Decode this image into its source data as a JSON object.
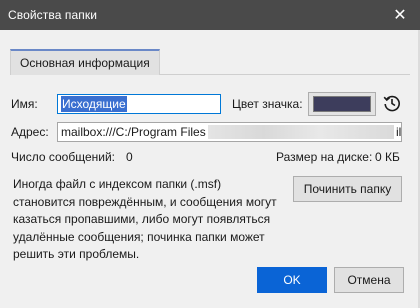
{
  "window": {
    "title": "Свойства папки",
    "close_glyph": "✕"
  },
  "tab": {
    "label": "Основная информация"
  },
  "name": {
    "label": "Имя:",
    "value": "Исходящие"
  },
  "icon_color": {
    "label": "Цвет значка:",
    "color": "#3d3d5c",
    "reset_icon": "reset-history-icon"
  },
  "address": {
    "label": "Адрес:",
    "value_visible": "mailbox:///C:/Program Files",
    "value_tail": "il"
  },
  "stats": {
    "messages_label": "Число сообщений:",
    "messages_value": "0",
    "size_label": "Размер на диске:",
    "size_value": "0 КБ"
  },
  "repair": {
    "text": "Иногда файл с индексом папки (.msf) становится повреждённым, и сообщения могут казаться пропавшими, либо могут появляться удалённые сообщения; починка папки может решить эти проблемы.",
    "button_label": "Починить папку"
  },
  "buttons": {
    "ok": "OK",
    "cancel": "Отмена"
  },
  "colors": {
    "accent": "#0a64d6",
    "titlebar": "#4a4a4a"
  }
}
